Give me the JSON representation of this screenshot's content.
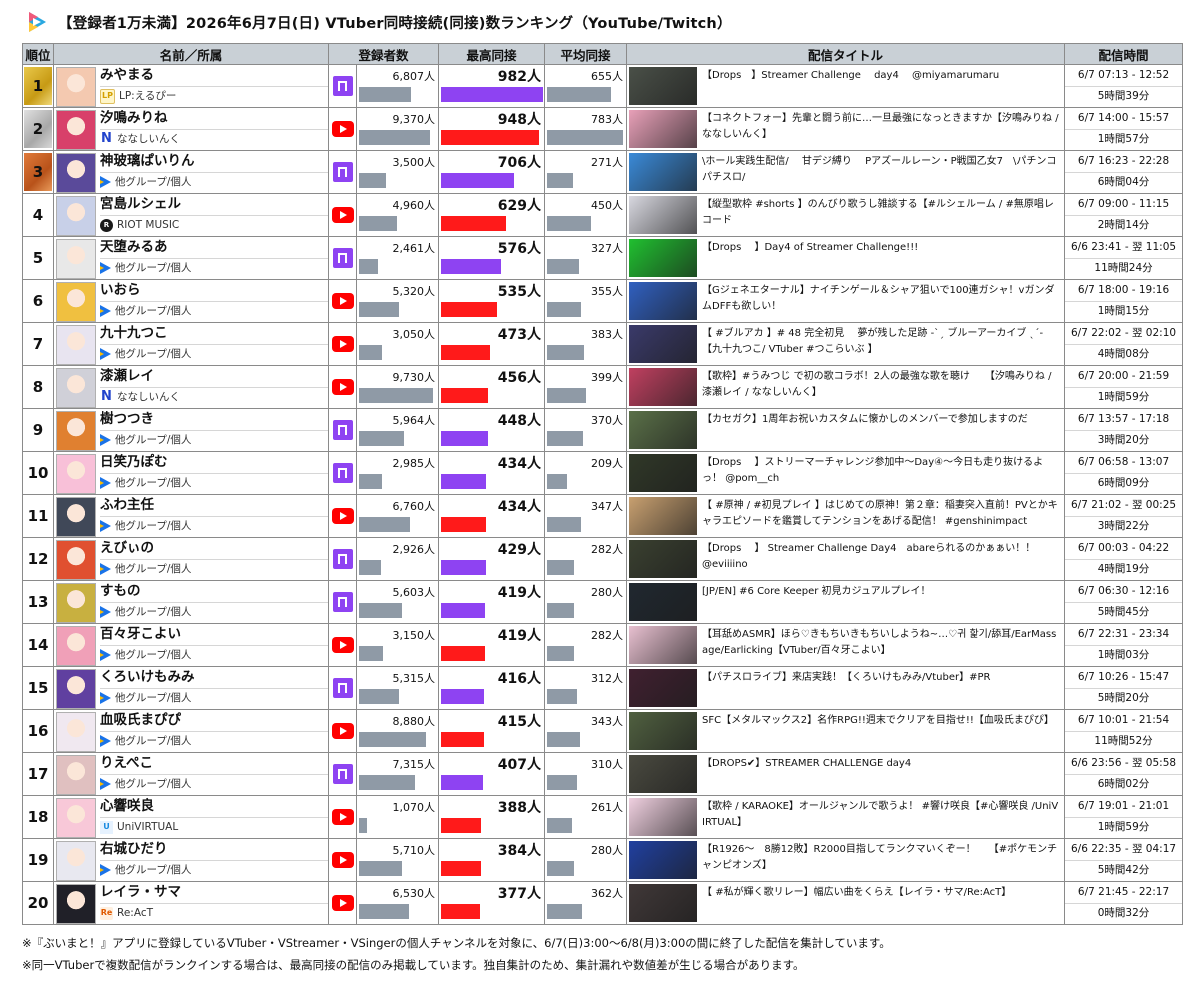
{
  "page": {
    "title": "【登録者1万未満】2026年6月7日(日) VTuber同時接続(同接)数ランキング（YouTube/Twitch）",
    "logo_icon": "vtuber-app-logo-icon"
  },
  "headers": {
    "rank": "順位",
    "name": "名前／所属",
    "subs": "登録者数",
    "peak": "最高同接",
    "avg": "平均同接",
    "stream_title": "配信タイトル",
    "stream_time": "配信時間"
  },
  "colors": {
    "twitch": "#8e43f2",
    "youtube": "#ff0000",
    "subs_bar": "#8f9aa6",
    "header_bg": "#c9d0d6",
    "gold": "#d4a81c",
    "silver": "#b0b0b0",
    "bronze": "#c8622a"
  },
  "scale": {
    "subs_max": 10000,
    "peak_max": 982,
    "avg_max": 783
  },
  "rows": [
    {
      "rank": "1",
      "name": "みやまる",
      "affiliation": "LP:えるぴー",
      "affil_icon": "lp-icon",
      "platform": "twitch",
      "subs": "6,807人",
      "subs_value": 6807,
      "peak": "982人",
      "peak_value": 982,
      "avg": "655人",
      "avg_value": 655,
      "title": "【Drops　】Streamer Challenge　 day4　 @miyamarumaru",
      "time": "6/7 07:13 - 12:52",
      "duration": "5時間39分",
      "avatar": "#f4c9b0",
      "thumb": "#4a5048"
    },
    {
      "rank": "2",
      "name": "汐鳴みりね",
      "affiliation": "ななしいんく",
      "affil_icon": "nanashi-inc-icon",
      "platform": "youtube",
      "subs": "9,370人",
      "subs_value": 9370,
      "peak": "948人",
      "peak_value": 948,
      "avg": "783人",
      "avg_value": 783,
      "title": "【コネクトフォー】先輩と闘う前に…一旦最強になっときますか【汐鳴みりね / ななしいんく】",
      "time": "6/7 14:00 - 15:57",
      "duration": "1時間57分",
      "avatar": "#d8406a",
      "thumb": "#e8a0b8"
    },
    {
      "rank": "3",
      "name": "神玻璃ぱいりん",
      "affiliation": "他グループ/個人",
      "affil_icon": "group-icon",
      "platform": "twitch",
      "subs": "3,500人",
      "subs_value": 3500,
      "peak": "706人",
      "peak_value": 706,
      "avg": "271人",
      "avg_value": 271,
      "title": "\\ホール実践生配信/　 甘デジ縛り　 Pアズールレーン・P戦国乙女7　\\パチンコパチスロ/",
      "time": "6/7 16:23 - 22:28",
      "duration": "6時間04分",
      "avatar": "#5a4a9a",
      "thumb": "#3a8ad8"
    },
    {
      "rank": "4",
      "name": "宮島ルシェル",
      "affiliation": "RIOT MUSIC",
      "affil_icon": "riot-music-icon",
      "platform": "youtube",
      "subs": "4,960人",
      "subs_value": 4960,
      "peak": "629人",
      "peak_value": 629,
      "avg": "450人",
      "avg_value": 450,
      "title": "【縦型歌枠 #shorts 】のんびり歌うし雑談する【#ルシェルーム / #無原唱レコード",
      "time": "6/7 09:00 - 11:15",
      "duration": "2時間14分",
      "avatar": "#c8d0e8",
      "thumb": "#d8d8e0"
    },
    {
      "rank": "5",
      "name": "天堕みるあ",
      "affiliation": "他グループ/個人",
      "affil_icon": "group-icon",
      "platform": "twitch",
      "subs": "2,461人",
      "subs_value": 2461,
      "peak": "576人",
      "peak_value": 576,
      "avg": "327人",
      "avg_value": 327,
      "title": "【Drops　 】Day4 of Streamer Challenge!!!",
      "time": "6/6 23:41 - 翌 11:05",
      "duration": "11時間24分",
      "avatar": "#e8e8e8",
      "thumb": "#20c030"
    },
    {
      "rank": "6",
      "name": "いおら",
      "affiliation": "他グループ/個人",
      "affil_icon": "group-icon",
      "platform": "youtube",
      "subs": "5,320人",
      "subs_value": 5320,
      "peak": "535人",
      "peak_value": 535,
      "avg": "355人",
      "avg_value": 355,
      "title": "【Gジェネエターナル】ナイチンゲール＆シャア狙いで100連ガシャ！vガンダムDFFも欲しい！",
      "time": "6/7 18:00 - 19:16",
      "duration": "1時間15分",
      "avatar": "#f0c040",
      "thumb": "#3060c0"
    },
    {
      "rank": "7",
      "name": "九十九つこ",
      "affiliation": "他グループ/個人",
      "affil_icon": "group-icon",
      "platform": "youtube",
      "subs": "3,050人",
      "subs_value": 3050,
      "peak": "473人",
      "peak_value": 473,
      "avg": "383人",
      "avg_value": 383,
      "title": "【 #ブルアカ 】# 48 完全初見　 夢が残した足跡 -ˋˏ ブルーアーカイブ ˎˊ-【九十九つこ/ VTuber #つこらいぶ 】",
      "time": "6/7 22:02 - 翌 02:10",
      "duration": "4時間08分",
      "avatar": "#e8e4f0",
      "thumb": "#3a3a6a"
    },
    {
      "rank": "8",
      "name": "漆瀬レイ",
      "affiliation": "ななしいんく",
      "affil_icon": "nanashi-inc-icon",
      "platform": "youtube",
      "subs": "9,730人",
      "subs_value": 9730,
      "peak": "456人",
      "peak_value": 456,
      "avg": "399人",
      "avg_value": 399,
      "title": "【歌枠】#うみつじ で初の歌コラボ！2人の最強な歌を聴け　　【汐鳴みりね / 漆瀬レイ / ななしいんく】",
      "time": "6/7 20:00 - 21:59",
      "duration": "1時間59分",
      "avatar": "#d0d0d8",
      "thumb": "#c04060"
    },
    {
      "rank": "9",
      "name": "樹つつき",
      "affiliation": "他グループ/個人",
      "affil_icon": "group-icon",
      "platform": "twitch",
      "subs": "5,964人",
      "subs_value": 5964,
      "peak": "448人",
      "peak_value": 448,
      "avg": "370人",
      "avg_value": 370,
      "title": "【カセガク】1周年お祝いカスタムに懐かしのメンバーで参加しますのだ",
      "time": "6/7 13:57 - 17:18",
      "duration": "3時間20分",
      "avatar": "#e08030",
      "thumb": "#5a7048"
    },
    {
      "rank": "10",
      "name": "日笑乃ぽむ",
      "affiliation": "他グループ/個人",
      "affil_icon": "group-icon",
      "platform": "twitch",
      "subs": "2,985人",
      "subs_value": 2985,
      "peak": "434人",
      "peak_value": 434,
      "avg": "209人",
      "avg_value": 209,
      "title": "【Drops　 】ストリーマーチャレンジ参加中～Day④～今日も走り抜けるよっ！ @pom__ch",
      "time": "6/7 06:58 - 13:07",
      "duration": "6時間09分",
      "avatar": "#f8c0d8",
      "thumb": "#303828"
    },
    {
      "rank": "11",
      "name": "ふわ主任",
      "affiliation": "他グループ/個人",
      "affil_icon": "group-icon",
      "platform": "youtube",
      "subs": "6,760人",
      "subs_value": 6760,
      "peak": "434人",
      "peak_value": 434,
      "avg": "347人",
      "avg_value": 347,
      "title": "【 #原神 / #初見プレイ 】はじめての原神！第２章：稲妻突入直前！PVとかキャラエピソードを鑑賞してテンションをあげる配信！ #genshinimpact",
      "time": "6/7 21:02 - 翌 00:25",
      "duration": "3時間22分",
      "avatar": "#404858",
      "thumb": "#c8a070"
    },
    {
      "rank": "12",
      "name": "えびぃの",
      "affiliation": "他グループ/個人",
      "affil_icon": "group-icon",
      "platform": "twitch",
      "subs": "2,926人",
      "subs_value": 2926,
      "peak": "429人",
      "peak_value": 429,
      "avg": "282人",
      "avg_value": 282,
      "title": "【Drops　 】 Streamer Challenge Day4　abareられるのかぁぁい！！　　@eviiiino",
      "time": "6/7 00:03 - 04:22",
      "duration": "4時間19分",
      "avatar": "#e05030",
      "thumb": "#3a4030"
    },
    {
      "rank": "13",
      "name": "すもの",
      "affiliation": "他グループ/個人",
      "affil_icon": "group-icon",
      "platform": "twitch",
      "subs": "5,603人",
      "subs_value": 5603,
      "peak": "419人",
      "peak_value": 419,
      "avg": "280人",
      "avg_value": 280,
      "title": "[JP/EN] #6 Core Keeper 初見カジュアルプレイ！",
      "time": "6/7 06:30 - 12:16",
      "duration": "5時間45分",
      "avatar": "#c8b040",
      "thumb": "#202830"
    },
    {
      "rank": "14",
      "name": "百々牙こよい",
      "affiliation": "他グループ/個人",
      "affil_icon": "group-icon",
      "platform": "youtube",
      "subs": "3,150人",
      "subs_value": 3150,
      "peak": "419人",
      "peak_value": 419,
      "avg": "282人",
      "avg_value": 282,
      "title": "【耳舐めASMR】ほら♡きもちいきもちいしようね~…♡귀 핥기/舔耳/EarMassage/Earlicking【VTuber/百々牙こよい】",
      "time": "6/7 22:31 - 23:34",
      "duration": "1時間03分",
      "avatar": "#f0a0b8",
      "thumb": "#e8c0d0"
    },
    {
      "rank": "15",
      "name": "くろいけもみみ",
      "affiliation": "他グループ/個人",
      "affil_icon": "group-icon",
      "platform": "twitch",
      "subs": "5,315人",
      "subs_value": 5315,
      "peak": "416人",
      "peak_value": 416,
      "avg": "312人",
      "avg_value": 312,
      "title": "【パチスロライブ】来店実践！【くろいけもみみ/Vtuber】#PR",
      "time": "6/7 10:26 - 15:47",
      "duration": "5時間20分",
      "avatar": "#6040a0",
      "thumb": "#402030"
    },
    {
      "rank": "16",
      "name": "血吸氏まぴぴ",
      "affiliation": "他グループ/個人",
      "affil_icon": "group-icon",
      "platform": "youtube",
      "subs": "8,880人",
      "subs_value": 8880,
      "peak": "415人",
      "peak_value": 415,
      "avg": "343人",
      "avg_value": 343,
      "title": "SFC【メタルマックス2】名作RPG!!週末でクリアを目指せ!!【血吸氏まぴぴ】",
      "time": "6/7 10:01 - 21:54",
      "duration": "11時間52分",
      "avatar": "#f0e8f0",
      "thumb": "#506040"
    },
    {
      "rank": "17",
      "name": "りえぺこ",
      "affiliation": "他グループ/個人",
      "affil_icon": "group-icon",
      "platform": "twitch",
      "subs": "7,315人",
      "subs_value": 7315,
      "peak": "407人",
      "peak_value": 407,
      "avg": "310人",
      "avg_value": 310,
      "title": "【DROPS✔】STREAMER CHALLENGE day4",
      "time": "6/6 23:56 - 翌 05:58",
      "duration": "6時間02分",
      "avatar": "#e0c0c0",
      "thumb": "#4a4a40"
    },
    {
      "rank": "18",
      "name": "心響咲良",
      "affiliation": "UniVIRTUAL",
      "affil_icon": "univirtual-icon",
      "platform": "youtube",
      "subs": "1,070人",
      "subs_value": 1070,
      "peak": "388人",
      "peak_value": 388,
      "avg": "261人",
      "avg_value": 261,
      "title": "【歌枠 / KARAOKE】オールジャンルで歌うよ！ #響け咲良【#心響咲良 /UniVIRTUAL】",
      "time": "6/7 19:01 - 21:01",
      "duration": "1時間59分",
      "avatar": "#f8c8d8",
      "thumb": "#f0d0e0"
    },
    {
      "rank": "19",
      "name": "右城ひだり",
      "affiliation": "他グループ/個人",
      "affil_icon": "group-icon",
      "platform": "youtube",
      "subs": "5,710人",
      "subs_value": 5710,
      "peak": "384人",
      "peak_value": 384,
      "avg": "280人",
      "avg_value": 280,
      "title": "【R1926～　8勝12敗】R2000目指してランクマいくぞー！　 【#ポケモンチャンピオンズ】",
      "time": "6/6 22:35 - 翌 04:17",
      "duration": "5時間42分",
      "avatar": "#e8e8f0",
      "thumb": "#2040a0"
    },
    {
      "rank": "20",
      "name": "レイラ・サマ",
      "affiliation": "Re:AcT",
      "affil_icon": "react-icon",
      "platform": "youtube",
      "subs": "6,530人",
      "subs_value": 6530,
      "peak": "377人",
      "peak_value": 377,
      "avg": "362人",
      "avg_value": 362,
      "title": "【 #私が輝く歌リレー】幅広い曲をくらえ【レイラ・サマ/Re:AcT】",
      "time": "6/7 21:45 - 22:17",
      "duration": "0時間32分",
      "avatar": "#202028",
      "thumb": "#403838"
    }
  ],
  "footer": {
    "note1": "※『ぶいまと！』アプリに登録しているVTuber・VStreamer・VSingerの個人チャンネルを対象に、6/7(日)3:00～6/8(月)3:00の間に終了した配信を集計しています。",
    "note2": "※同一VTuberで複数配信がランクインする場合は、最高同接の配信のみ掲載しています。独自集計のため、集計漏れや数値差が生じる場合があります。"
  }
}
